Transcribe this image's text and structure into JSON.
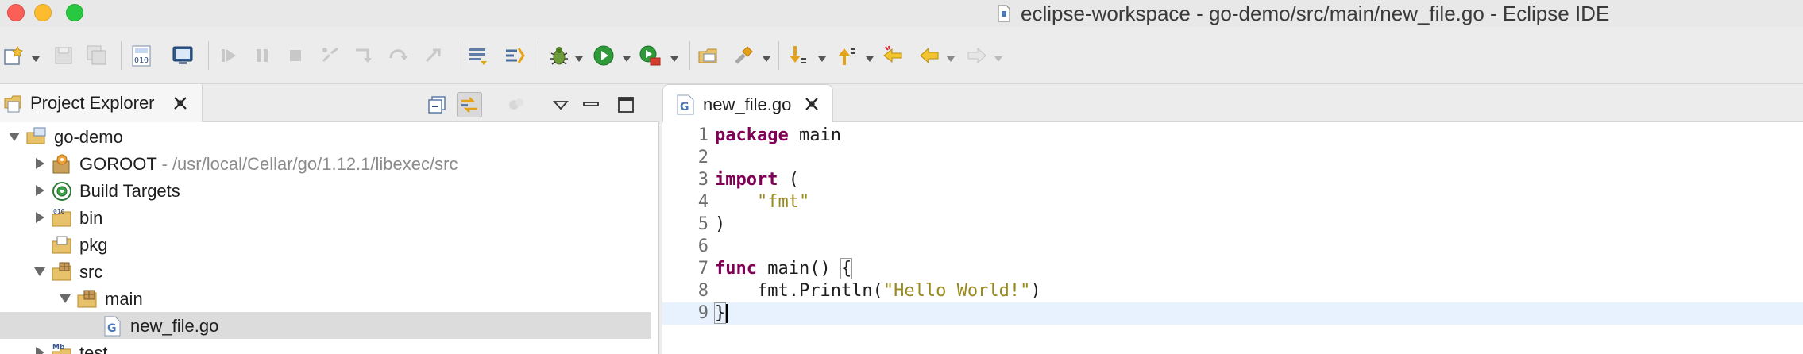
{
  "window": {
    "title": "eclipse-workspace - go-demo/src/main/new_file.go - Eclipse IDE"
  },
  "project_explorer": {
    "tab_label": "Project Explorer",
    "tree": [
      {
        "label": "go-demo",
        "desc": "",
        "icon": "project-folder-icon",
        "level": 0,
        "expanded": true,
        "selected": false
      },
      {
        "label": "GOROOT",
        "desc": " - /usr/local/Cellar/go/1.12.1/libexec/src",
        "icon": "goroot-library-icon",
        "level": 1,
        "expanded": false,
        "selected": false
      },
      {
        "label": "Build Targets",
        "desc": "",
        "icon": "build-targets-icon",
        "level": 1,
        "expanded": false,
        "selected": false
      },
      {
        "label": "bin",
        "desc": "",
        "icon": "binary-folder-icon",
        "level": 1,
        "expanded": false,
        "selected": false
      },
      {
        "label": "pkg",
        "desc": "",
        "icon": "package-folder-icon",
        "level": 1,
        "expanded": null,
        "selected": false
      },
      {
        "label": "src",
        "desc": "",
        "icon": "source-folder-icon",
        "level": 1,
        "expanded": true,
        "selected": false
      },
      {
        "label": "main",
        "desc": "",
        "icon": "package-icon",
        "level": 2,
        "expanded": true,
        "selected": false
      },
      {
        "label": "new_file.go",
        "desc": "",
        "icon": "go-file-icon",
        "level": 3,
        "expanded": null,
        "selected": true
      },
      {
        "label": "test",
        "desc": "",
        "icon": "test-folder-icon",
        "level": 1,
        "expanded": false,
        "selected": false
      }
    ]
  },
  "editor": {
    "tab_label": "new_file.go",
    "lines": [
      {
        "num": "1",
        "parts": [
          {
            "t": "package",
            "c": "kw"
          },
          {
            "t": " main",
            "c": ""
          }
        ]
      },
      {
        "num": "2",
        "parts": []
      },
      {
        "num": "3",
        "parts": [
          {
            "t": "import",
            "c": "kw"
          },
          {
            "t": " (",
            "c": ""
          }
        ]
      },
      {
        "num": "4",
        "parts": [
          {
            "t": "    ",
            "c": ""
          },
          {
            "t": "\"fmt\"",
            "c": "str"
          }
        ]
      },
      {
        "num": "5",
        "parts": [
          {
            "t": ")",
            "c": ""
          }
        ]
      },
      {
        "num": "6",
        "parts": []
      },
      {
        "num": "7",
        "parts": [
          {
            "t": "func",
            "c": "kw"
          },
          {
            "t": " main() ",
            "c": ""
          },
          {
            "t": "{",
            "c": "brace"
          }
        ]
      },
      {
        "num": "8",
        "parts": [
          {
            "t": "    fmt.Println(",
            "c": ""
          },
          {
            "t": "\"Hello World!\"",
            "c": "str"
          },
          {
            "t": ")",
            "c": ""
          }
        ]
      },
      {
        "num": "9",
        "parts": [
          {
            "t": "}",
            "c": "brace"
          },
          {
            "t": "",
            "c": "caret"
          }
        ]
      }
    ],
    "current_line": "9"
  },
  "colors": {
    "keyword": "#7f0055",
    "string": "#9a8a1e",
    "current_line": "#e8f2fe",
    "selection": "#dcdcdc"
  }
}
